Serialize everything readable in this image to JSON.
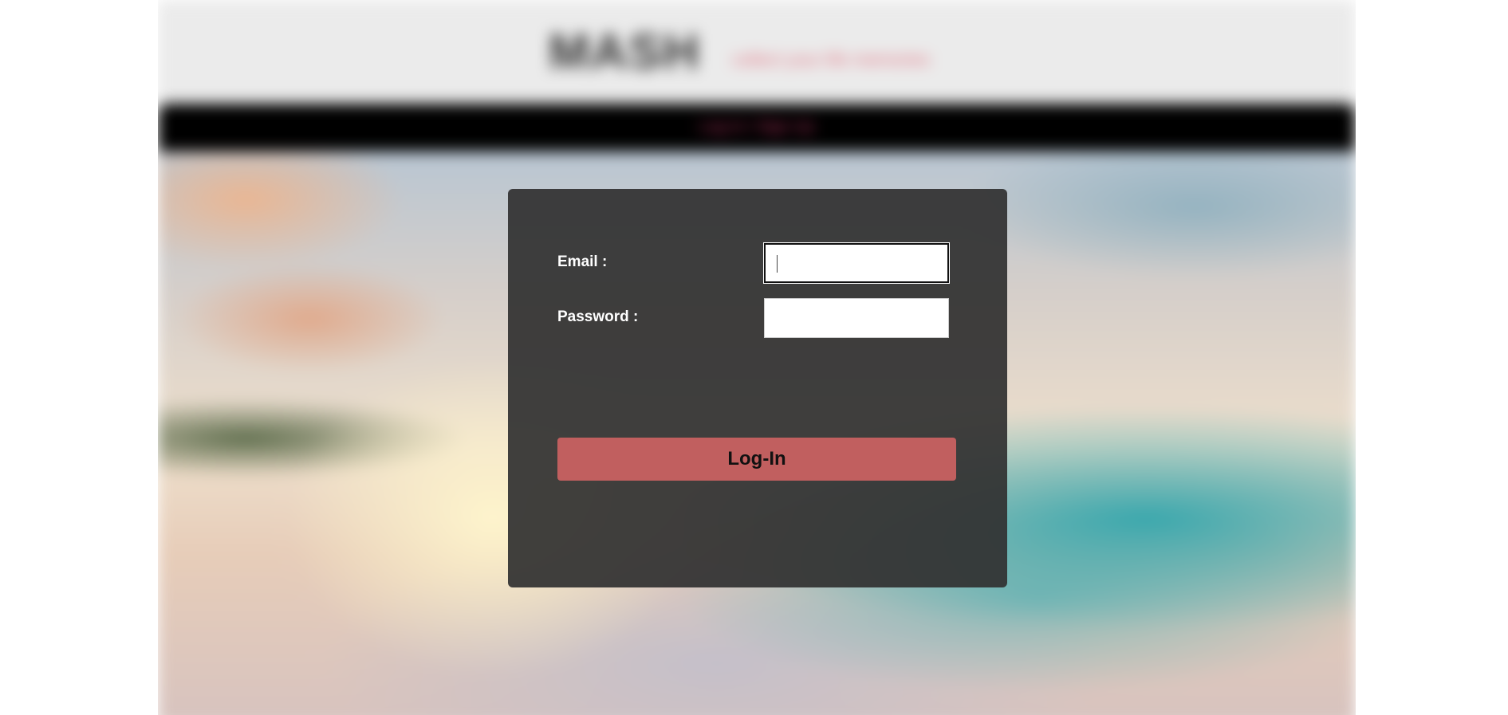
{
  "header": {
    "logo_text": "MASH",
    "tagline": "collect your life memories"
  },
  "navbar": {
    "text": "Log In / Sign Up"
  },
  "login_form": {
    "email_label": "Email :",
    "email_value": "",
    "password_label": "Password :",
    "password_value": "",
    "submit_label": "Log-In"
  },
  "colors": {
    "card_background": "#323232",
    "button_background": "#c15f5f",
    "navbar_background": "#000000",
    "header_background": "#ebebeb",
    "tagline_color": "#e06c7c"
  }
}
